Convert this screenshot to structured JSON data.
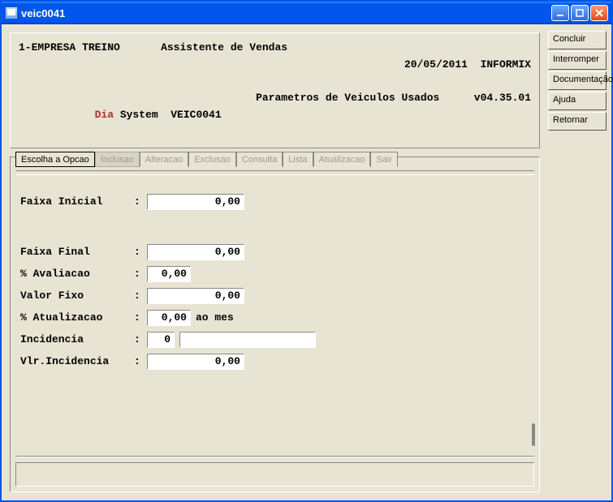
{
  "window": {
    "title": "veic0041"
  },
  "header": {
    "company": "1-EMPRESA TREINO",
    "assistant": "Assistente de Vendas",
    "date": "20/05/2011",
    "db": "INFORMIX",
    "brand_prefix": "Dia",
    "brand_rest": " System  VEIC0041",
    "subtitle": "Parametros de Veiculos Usados",
    "version": "v04.35.01"
  },
  "tabs": {
    "escolha": "Escolha a Opcao",
    "inclusao": "Inclusao",
    "alteracao": "Alteracao",
    "exclusao": "Exclusao",
    "consulta": "Consulta",
    "lista": "Lista",
    "atualizacao": "Atualizacao",
    "sair": "Sair"
  },
  "form": {
    "labels": {
      "faixa_inicial": "Faixa Inicial",
      "faixa_final": "Faixa Final",
      "avaliacao": "% Avaliacao",
      "valor_fixo": "Valor Fixo",
      "atualizacao": "% Atualizacao",
      "incidencia": "Incidencia",
      "vlr_incidencia": "Vlr.Incidencia"
    },
    "colon": ":",
    "values": {
      "faixa_inicial": "0,00",
      "faixa_final": "0,00",
      "avaliacao": "0,00",
      "valor_fixo": "0,00",
      "atualizacao": "0,00",
      "atualizacao_suffix": "ao mes",
      "incidencia": "0",
      "incidencia_desc": "",
      "vlr_incidencia": "0,00"
    }
  },
  "sidebar": {
    "concluir": "Concluir",
    "interromper": "Interromper",
    "documentacao": "Documentação",
    "ajuda": "Ajuda",
    "retornar": "Retornar"
  }
}
